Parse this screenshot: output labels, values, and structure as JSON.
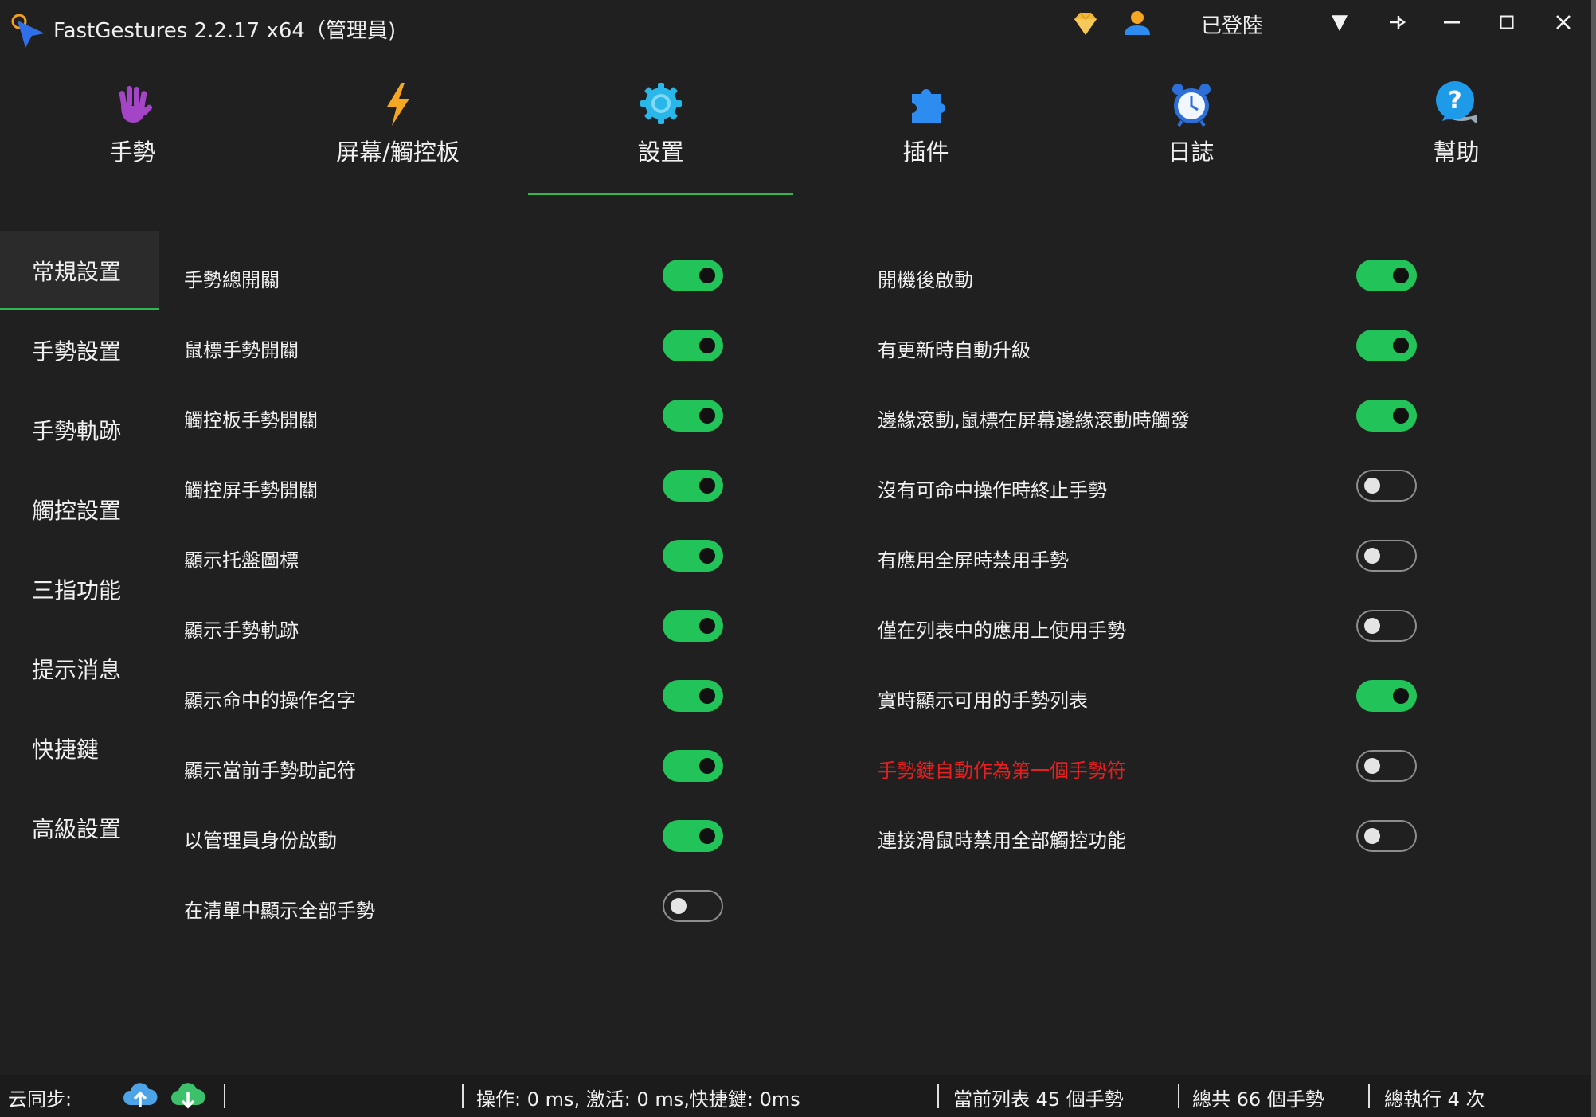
{
  "window": {
    "title": "FastGestures 2.2.17 x64（管理員)",
    "login_status": "已登陸"
  },
  "nav": [
    {
      "label": "手勢",
      "icon": "hand-icon"
    },
    {
      "label": "屏幕/觸控板",
      "icon": "lightning-icon"
    },
    {
      "label": "設置",
      "icon": "gear-icon",
      "active": true
    },
    {
      "label": "插件",
      "icon": "puzzle-icon"
    },
    {
      "label": "日誌",
      "icon": "alarm-clock-icon"
    },
    {
      "label": "幫助",
      "icon": "help-icon"
    }
  ],
  "sidebar": [
    {
      "label": "常規設置",
      "active": true
    },
    {
      "label": "手勢設置"
    },
    {
      "label": "手勢軌跡"
    },
    {
      "label": "觸控設置"
    },
    {
      "label": "三指功能"
    },
    {
      "label": "提示消息"
    },
    {
      "label": "快捷鍵"
    },
    {
      "label": "高級設置"
    }
  ],
  "settings_left": [
    {
      "label": "手勢總開關",
      "on": true
    },
    {
      "label": "鼠標手勢開關",
      "on": true
    },
    {
      "label": "觸控板手勢開關",
      "on": true
    },
    {
      "label": "觸控屏手勢開關",
      "on": true
    },
    {
      "label": "顯示托盤圖標",
      "on": true
    },
    {
      "label": "顯示手勢軌跡",
      "on": true
    },
    {
      "label": "顯示命中的操作名字",
      "on": true
    },
    {
      "label": "顯示當前手勢助記符",
      "on": true
    },
    {
      "label": "以管理員身份啟動",
      "on": true
    },
    {
      "label": "在清單中顯示全部手勢",
      "on": false
    }
  ],
  "settings_right": [
    {
      "label": "開機後啟動",
      "on": true
    },
    {
      "label": "有更新時自動升級",
      "on": true
    },
    {
      "label": "邊緣滾動,鼠標在屏幕邊緣滾動時觸發",
      "on": true
    },
    {
      "label": "沒有可命中操作時終止手勢",
      "on": false
    },
    {
      "label": "有應用全屏時禁用手勢",
      "on": false
    },
    {
      "label": "僅在列表中的應用上使用手勢",
      "on": false
    },
    {
      "label": "實時顯示可用的手勢列表",
      "on": true
    },
    {
      "label": "手勢鍵自動作為第一個手勢符",
      "on": false,
      "highlight": "#e42020"
    },
    {
      "label": "連接滑鼠時禁用全部觸控功能",
      "on": false
    }
  ],
  "statusbar": {
    "cloud_sync": "云同步:",
    "timing": "操作: 0 ms, 激活: 0 ms,快捷鍵: 0ms",
    "current_list": "當前列表 45 個手勢",
    "total": "總共 66 個手勢",
    "executed": "總執行 4 次"
  },
  "colors": {
    "background": "#202020",
    "accent_green": "#22c45a",
    "warning_red": "#e42020"
  }
}
